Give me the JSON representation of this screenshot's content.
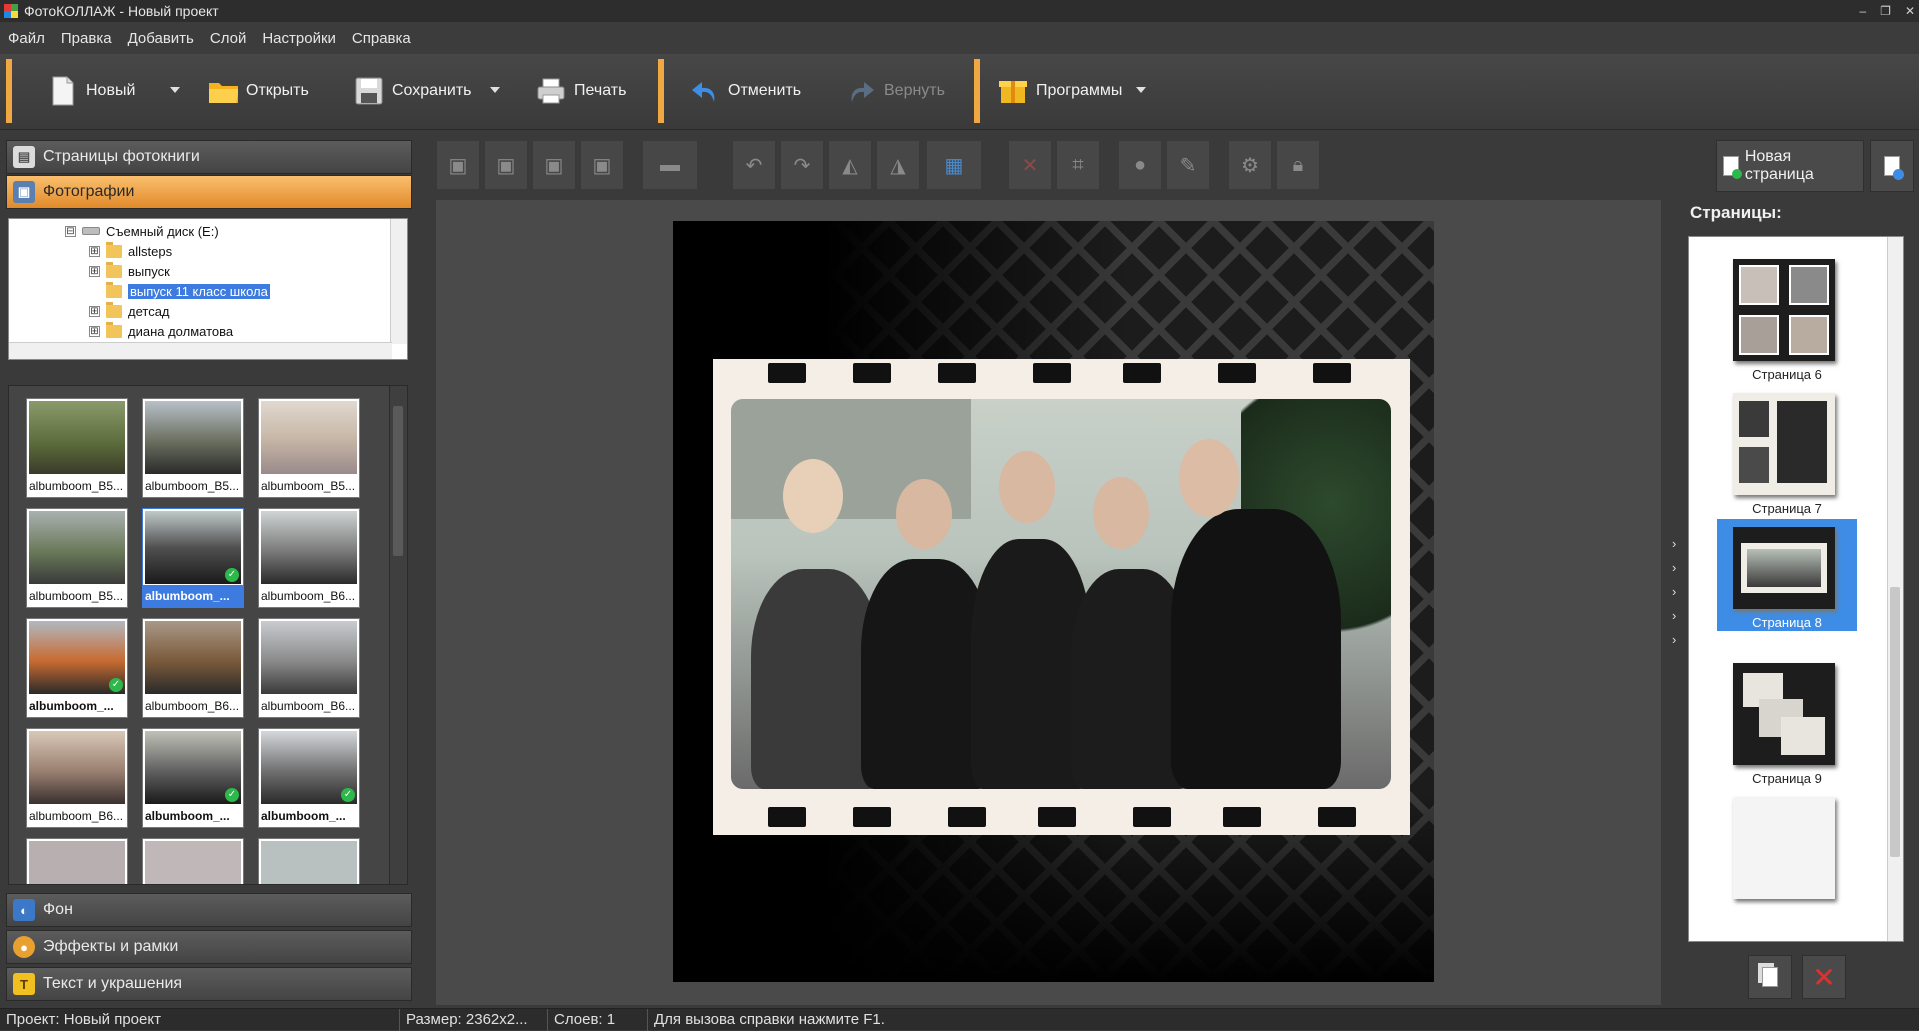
{
  "window": {
    "title": "ФотоКОЛЛАЖ - Новый проект"
  },
  "menu": [
    "Файл",
    "Правка",
    "Добавить",
    "Слой",
    "Настройки",
    "Справка"
  ],
  "toolbar": {
    "new_label": "Новый",
    "open_label": "Открыть",
    "save_label": "Сохранить",
    "print_label": "Печать",
    "undo_label": "Отменить",
    "redo_label": "Вернуть",
    "programs_label": "Программы"
  },
  "left_panel": {
    "sections": {
      "pages": "Страницы фотокниги",
      "photos": "Фотографии",
      "background": "Фон",
      "effects": "Эффекты и рамки",
      "text": "Текст и украшения"
    },
    "tree": [
      {
        "label": "Съемный диск (E:)",
        "expander": "⊟",
        "level": 0
      },
      {
        "label": "allsteps",
        "expander": "⊞",
        "level": 1
      },
      {
        "label": "выпуск",
        "expander": "⊞",
        "level": 1
      },
      {
        "label": "выпуск 11 класс школа",
        "expander": "",
        "level": 1,
        "selected": true
      },
      {
        "label": "детсад",
        "expander": "⊞",
        "level": 1
      },
      {
        "label": "диана долматова",
        "expander": "⊞",
        "level": 1
      }
    ],
    "thumbnails": [
      {
        "caption": "albumboom_B5...",
        "state": "normal",
        "checked": false
      },
      {
        "caption": "albumboom_B5...",
        "state": "normal",
        "checked": false
      },
      {
        "caption": "albumboom_B5...",
        "state": "normal",
        "checked": false
      },
      {
        "caption": "albumboom_B5...",
        "state": "normal",
        "checked": false
      },
      {
        "caption": "albumboom_...",
        "state": "selected",
        "checked": true
      },
      {
        "caption": "albumboom_B6...",
        "state": "normal",
        "checked": false
      },
      {
        "caption": "albumboom_...",
        "state": "bold",
        "checked": true
      },
      {
        "caption": "albumboom_B6...",
        "state": "normal",
        "checked": false
      },
      {
        "caption": "albumboom_B6...",
        "state": "normal",
        "checked": false
      },
      {
        "caption": "albumboom_B6...",
        "state": "normal",
        "checked": false
      },
      {
        "caption": "albumboom_...",
        "state": "bold",
        "checked": true
      },
      {
        "caption": "albumboom_...",
        "state": "bold",
        "checked": true
      }
    ]
  },
  "right_panel": {
    "new_page_label": "Новая страница",
    "pages_title": "Страницы:",
    "pages": [
      {
        "label": "Страница 6",
        "selected": false
      },
      {
        "label": "Страница 7",
        "selected": false
      },
      {
        "label": "Страница 8",
        "selected": true
      },
      {
        "label": "Страница 9",
        "selected": false
      }
    ]
  },
  "status": {
    "project": "Проект:  Новый проект",
    "size": "Размер:  2362x2...",
    "layers": "Слоев:  1",
    "hint": "Для вызова справки нажмите F1."
  },
  "colors": {
    "accent": "#f0a843",
    "selection": "#3d7be0",
    "check": "#2db84b"
  }
}
